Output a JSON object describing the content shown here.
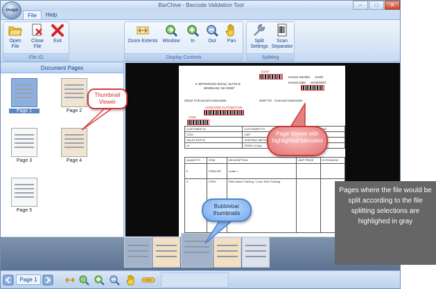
{
  "window": {
    "title": "BarChive - Barcode Validation Tool",
    "app_logo_text": "image"
  },
  "menu": {
    "tabs": [
      "File",
      "Help"
    ]
  },
  "ribbon": {
    "file_io": {
      "label": "File IO",
      "buttons": [
        "Open File",
        "Close File",
        "Exit"
      ]
    },
    "display_controls": {
      "label": "Display Controls",
      "buttons": [
        "Zoom Extents",
        "Window",
        "In",
        "Out",
        "Pan"
      ]
    },
    "splitting": {
      "label": "Splitting",
      "buttons": [
        "Split Settings",
        "Scan Separator"
      ]
    }
  },
  "left_panel": {
    "header": "Document Pages",
    "pages": [
      "Page 1",
      "Page 2",
      "Page 3",
      "Page 4",
      "Page 5"
    ],
    "selected_page": "Page 1"
  },
  "document": {
    "invoice_number_label": "Invoice Number",
    "invoice_number": "11240",
    "invoice_date_label": "Invoice Date",
    "invoice_date": "01/30/2007",
    "barcode_top": "11240",
    "address_line1": "5 JEFFERSON ROAD, SUITE B",
    "address_line2": "WINDHAM, NH 03087",
    "sold_to_label": "SOLD TO:",
    "sold_to": "Concord Automotive",
    "ship_to_label": "SHIP TO:",
    "ship_to": "Concord Automotive",
    "barcode_customer": "CONCORD AUTOMOTIVE",
    "barcode_id": "C233",
    "table": {
      "headers1": [
        "CUSTOMER ID",
        "CUSTOMER PO",
        "PAYM"
      ],
      "row1": [
        "C233",
        "2467",
        ""
      ],
      "headers2": [
        "SALES REP ID",
        "SHIPPING METHOD",
        ""
      ],
      "row2": [
        "LV",
        "FEDEX 2-Day",
        "01"
      ],
      "items_header": [
        "QUANTITY",
        "ITEM",
        "DESCRIPTION",
        "UNIT PRICE",
        "EXTENSION"
      ],
      "items": [
        [
          "5",
          "27804-RR",
          "router I",
          "",
          ""
        ],
        [
          "4",
          "27810",
          "Web-based Training, 1-hour Web Training",
          "",
          ""
        ]
      ]
    }
  },
  "navbar": {
    "current_page": "Page 1"
  },
  "callouts": {
    "thumbnail_viewer": "Thumbnail Viewer",
    "page_viewer": "Page Viewer with highlighted barcodes",
    "bubblebar": "Bubblebar thumbnails",
    "note": "Pages where the file would be split according to the file splitting selections are highlighed in gray"
  },
  "colors": {
    "ribbon_blue": "#dce8f7",
    "accent": "#15428b",
    "callout_red": "#d63b3b",
    "note_gray": "#666666"
  }
}
